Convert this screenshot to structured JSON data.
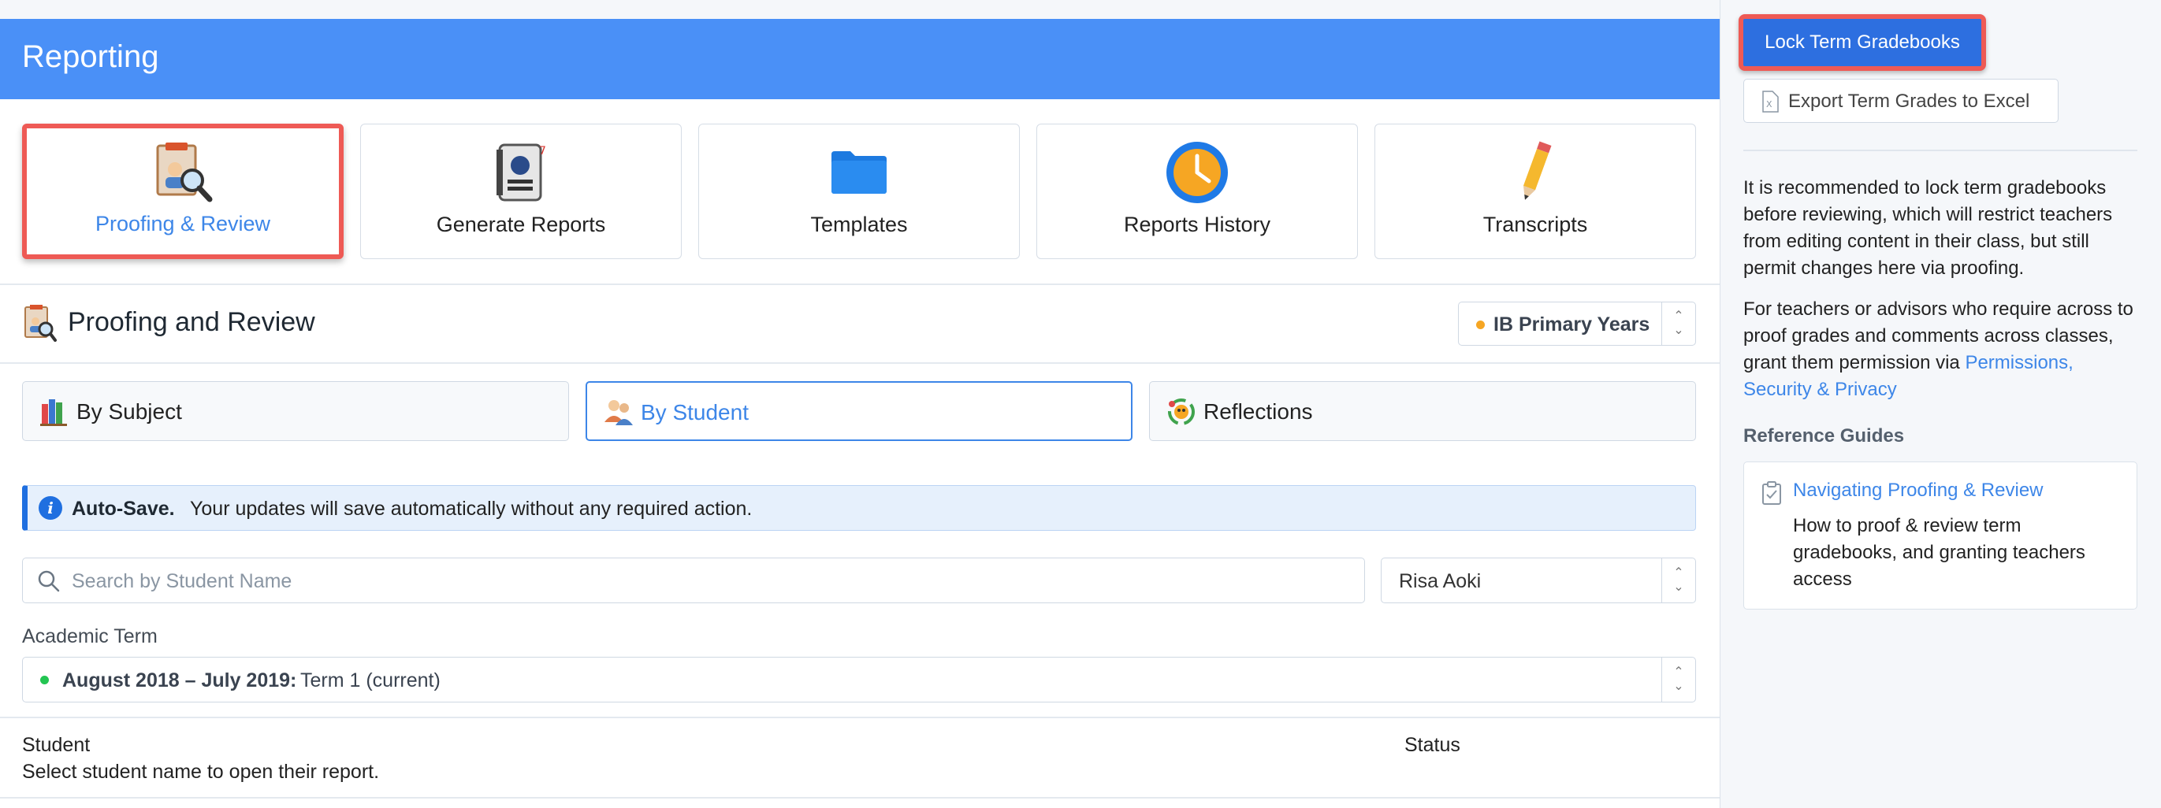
{
  "header": {
    "title": "Reporting"
  },
  "nav_cards": [
    {
      "label": "Proofing & Review",
      "active": true
    },
    {
      "label": "Generate Reports"
    },
    {
      "label": "Templates"
    },
    {
      "label": "Reports History"
    },
    {
      "label": "Transcripts"
    }
  ],
  "section": {
    "title": "Proofing and Review",
    "program_select": {
      "value": "IB Primary Years"
    }
  },
  "tabs": [
    {
      "label": "By Subject"
    },
    {
      "label": "By Student",
      "active": true
    },
    {
      "label": "Reflections"
    }
  ],
  "alert": {
    "bold": "Auto-Save.",
    "message": "Your updates will save automatically without any required action."
  },
  "search": {
    "placeholder": "Search by Student Name"
  },
  "student_select": {
    "value": "Risa Aoki"
  },
  "academic_term": {
    "label": "Academic Term",
    "range": "August 2018 – July 2019:",
    "term": "Term 1 (current)"
  },
  "table": {
    "col_student": "Student",
    "col_status": "Status",
    "hint": "Select student name to open their report."
  },
  "sidebar": {
    "lock_button": "Lock Term Gradebooks",
    "export_button": "Export Term Grades to Excel",
    "para1": "It is recommended to lock term gradebooks before reviewing, which will restrict teachers from editing content in their class, but still permit changes here via proofing.",
    "para2": "For teachers or advisors who require across to proof grades and comments across classes, grant them permission via",
    "para2_link": "Permissions, Security & Privacy",
    "ref_heading": "Reference Guides",
    "guide": {
      "title": "Navigating Proofing & Review",
      "description": "How to proof & review term gradebooks, and granting teachers access"
    }
  },
  "colors": {
    "header_bg": "#4a90f7",
    "accent": "#3d86e8",
    "highlight": "#ee5a55",
    "lock_button_bg": "#2d6fe0"
  }
}
